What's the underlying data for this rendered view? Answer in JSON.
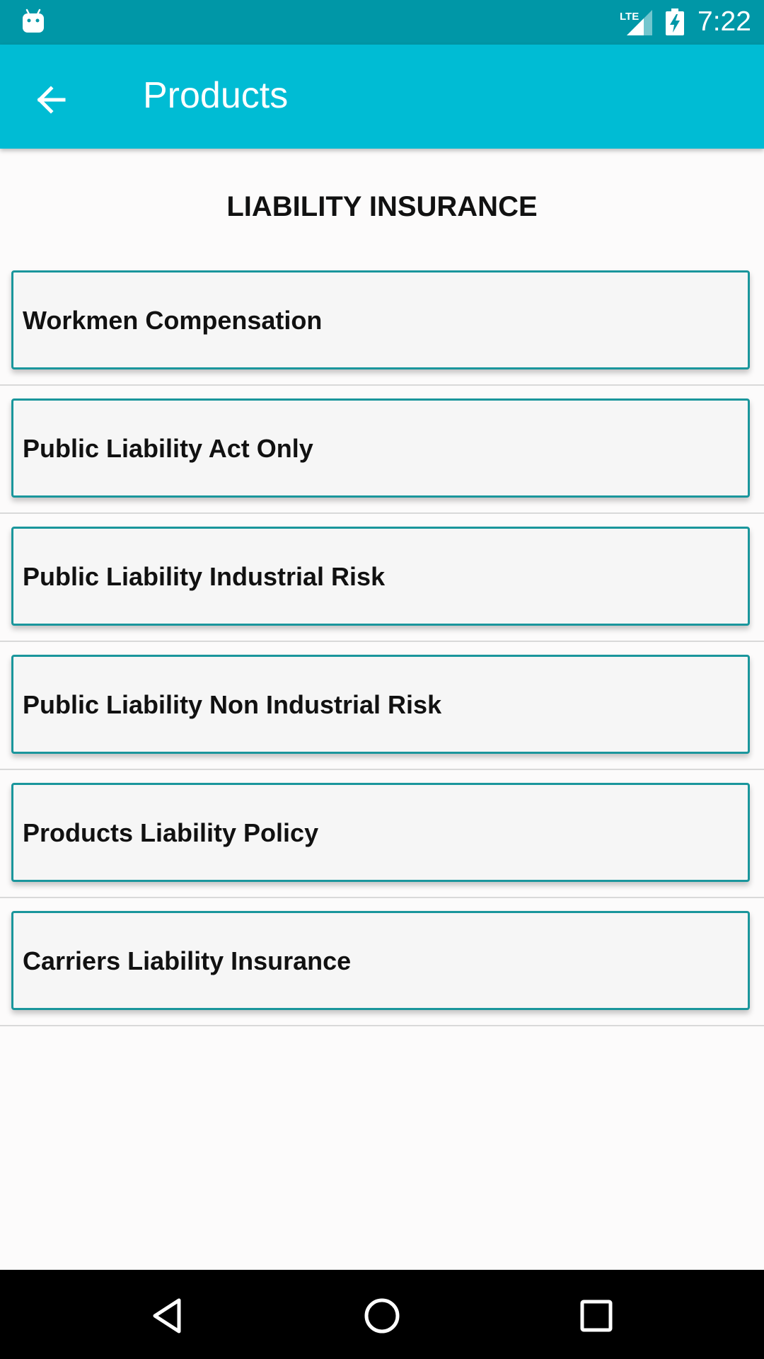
{
  "status_bar": {
    "time": "7:22",
    "network_label": "LTE",
    "icons": [
      "android-icon",
      "lte-signal-icon",
      "battery-charging-icon"
    ]
  },
  "app_bar": {
    "title": "Products",
    "back_icon": "arrow-left-icon"
  },
  "section": {
    "heading": "LIABILITY INSURANCE"
  },
  "products": [
    {
      "label": "Workmen Compensation"
    },
    {
      "label": "Public Liability Act Only"
    },
    {
      "label": "Public Liability Industrial Risk"
    },
    {
      "label": "Public Liability Non Industrial Risk"
    },
    {
      "label": "Products Liability Policy"
    },
    {
      "label": "Carriers Liability Insurance"
    }
  ],
  "nav_bar": {
    "icons": [
      "nav-back-icon",
      "nav-home-icon",
      "nav-recents-icon"
    ]
  },
  "colors": {
    "status_bar": "#0097a7",
    "app_bar": "#00bcd4",
    "card_border": "#1a969c",
    "card_bg": "#f6f6f6",
    "page_bg": "#fcfbfb"
  }
}
